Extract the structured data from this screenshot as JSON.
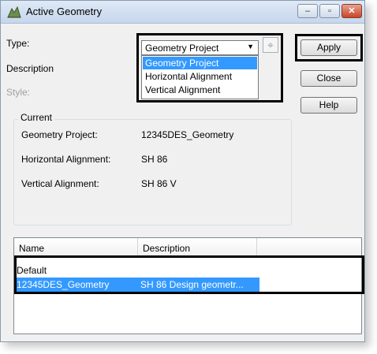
{
  "window": {
    "title": "Active Geometry"
  },
  "caption_buttons": {
    "minimize": "–",
    "maximize": "▫",
    "close": "✕"
  },
  "type_label": "Type:",
  "description_label": "Description",
  "style_label": "Style:",
  "type_combo": {
    "selected": "Geometry Project"
  },
  "type_options": [
    "Geometry Project",
    "Horizontal Alignment",
    "Vertical Alignment"
  ],
  "buttons": {
    "apply": "Apply",
    "close": "Close",
    "help": "Help"
  },
  "current": {
    "legend": "Current",
    "rows": [
      {
        "label": "Geometry Project:",
        "value": "12345DES_Geometry"
      },
      {
        "label": "Horizontal Alignment:",
        "value": "SH 86"
      },
      {
        "label": "Vertical Alignment:",
        "value": "SH 86 V"
      }
    ]
  },
  "list": {
    "columns": [
      "Name",
      "Description"
    ],
    "rows": [
      {
        "name": "Default",
        "description": ""
      },
      {
        "name": "12345DES_Geometry",
        "description": "SH 86 Design geometr..."
      }
    ]
  },
  "colors": {
    "selection": "#3399ff",
    "window_bg": "#f0f0f0",
    "highlight_border": "#000000"
  }
}
